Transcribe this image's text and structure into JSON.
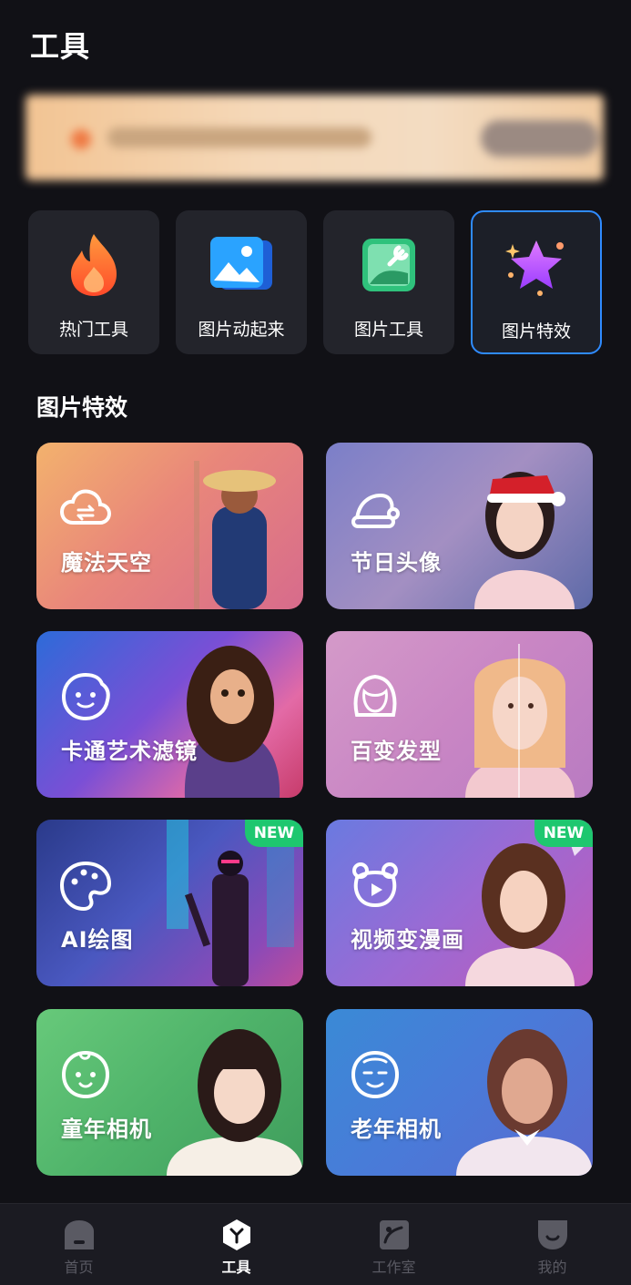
{
  "header": {
    "title": "工具"
  },
  "tools": [
    {
      "label": "热门工具",
      "icon": "flame-icon"
    },
    {
      "label": "图片动起来",
      "icon": "animated-image-icon"
    },
    {
      "label": "图片工具",
      "icon": "image-wrench-icon"
    },
    {
      "label": "图片特效",
      "icon": "star-sparkle-icon",
      "selected": true
    }
  ],
  "section": {
    "title": "图片特效"
  },
  "effects": [
    {
      "label": "魔法天空",
      "icon": "cloud-icon",
      "badge": ""
    },
    {
      "label": "节日头像",
      "icon": "santa-hat-icon",
      "badge": ""
    },
    {
      "label": "卡通艺术滤镜",
      "icon": "cartoon-face-icon",
      "badge": ""
    },
    {
      "label": "百变发型",
      "icon": "hairstyle-icon",
      "badge": ""
    },
    {
      "label": "AI绘图",
      "icon": "palette-icon",
      "badge": "NEW"
    },
    {
      "label": "视频变漫画",
      "icon": "bear-play-icon",
      "badge": "NEW"
    },
    {
      "label": "童年相机",
      "icon": "baby-face-icon",
      "badge": ""
    },
    {
      "label": "老年相机",
      "icon": "elder-face-icon",
      "badge": ""
    }
  ],
  "tabbar": [
    {
      "label": "首页",
      "icon": "home-icon"
    },
    {
      "label": "工具",
      "icon": "tools-icon",
      "active": true
    },
    {
      "label": "工作室",
      "icon": "studio-icon"
    },
    {
      "label": "我的",
      "icon": "profile-icon"
    }
  ],
  "colors": {
    "accent": "#2f8bff",
    "background": "#111116",
    "badge": "#1ec76f"
  }
}
